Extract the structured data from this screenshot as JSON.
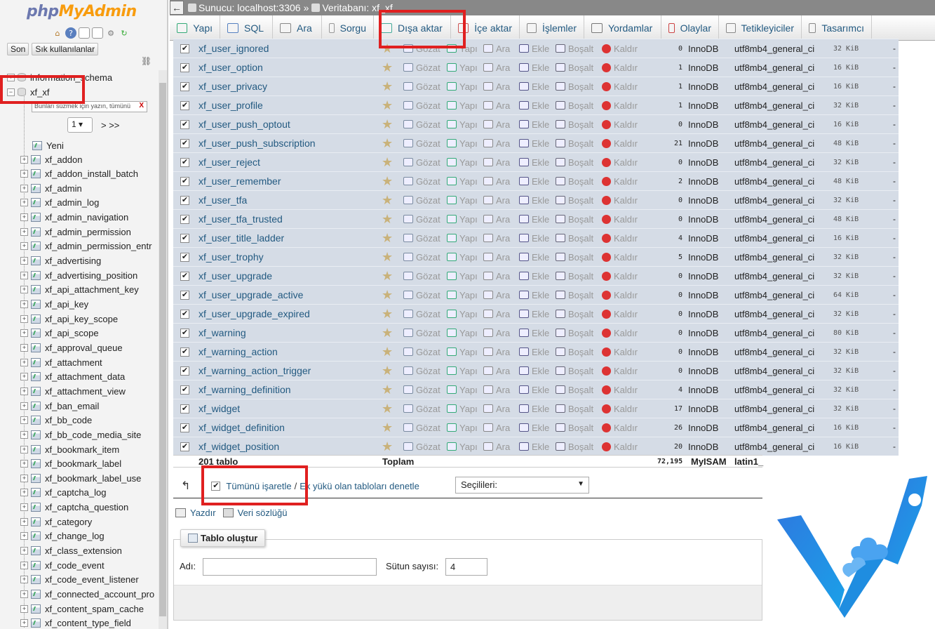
{
  "nav": {
    "logo_php": "php",
    "logo_myadmin": "MyAdmin",
    "buttons": [
      "Son",
      "Sık kullanılanlar"
    ],
    "db_items": [
      {
        "label": "information_schema"
      },
      {
        "label": "xf_xf"
      }
    ],
    "filter_placeholder": "Bunları süzmek için yazın, tümünü",
    "filter_clear": "X",
    "page_value": "1",
    "page_next": "> >>",
    "new_label": "Yeni",
    "tables": [
      "xf_addon",
      "xf_addon_install_batch",
      "xf_admin",
      "xf_admin_log",
      "xf_admin_navigation",
      "xf_admin_permission",
      "xf_admin_permission_entr",
      "xf_advertising",
      "xf_advertising_position",
      "xf_api_attachment_key",
      "xf_api_key",
      "xf_api_key_scope",
      "xf_api_scope",
      "xf_approval_queue",
      "xf_attachment",
      "xf_attachment_data",
      "xf_attachment_view",
      "xf_ban_email",
      "xf_bb_code",
      "xf_bb_code_media_site",
      "xf_bookmark_item",
      "xf_bookmark_label",
      "xf_bookmark_label_use",
      "xf_captcha_log",
      "xf_captcha_question",
      "xf_category",
      "xf_change_log",
      "xf_class_extension",
      "xf_code_event",
      "xf_code_event_listener",
      "xf_connected_account_pro",
      "xf_content_spam_cache",
      "xf_content_type_field"
    ]
  },
  "topbar": {
    "back": "←",
    "server": "Sunucu: localhost:3306",
    "sep": "»",
    "database": "Veritabanı: xf_xf"
  },
  "tabs": [
    {
      "label": "Yapı",
      "icon": "structure-icon",
      "color": "#3a7"
    },
    {
      "label": "SQL",
      "icon": "sql-icon",
      "color": "#5580c0"
    },
    {
      "label": "Ara",
      "icon": "search-icon",
      "color": "#888"
    },
    {
      "label": "Sorgu",
      "icon": "query-icon",
      "color": "#999"
    },
    {
      "label": "Dışa aktar",
      "icon": "export-icon",
      "color": "#4a9"
    },
    {
      "label": "İçe aktar",
      "icon": "import-icon",
      "color": "#c55"
    },
    {
      "label": "İşlemler",
      "icon": "wrench-icon",
      "color": "#888"
    },
    {
      "label": "Yordamlar",
      "icon": "routines-icon",
      "color": "#777"
    },
    {
      "label": "Olaylar",
      "icon": "clock-icon",
      "color": "#c44"
    },
    {
      "label": "Tetikleyiciler",
      "icon": "triggers-icon",
      "color": "#888"
    },
    {
      "label": "Tasarımcı",
      "icon": "designer-icon",
      "color": "#888"
    }
  ],
  "actions": {
    "browse": "Gözat",
    "structure": "Yapı",
    "search": "Ara",
    "insert": "Ekle",
    "empty": "Boşalt",
    "drop": "Kaldır"
  },
  "rows": [
    {
      "name": "xf_user_ignored",
      "rows": "0",
      "engine": "InnoDB",
      "collation": "utf8mb4_general_ci",
      "size": "32 KiB",
      "overhead": "-"
    },
    {
      "name": "xf_user_option",
      "rows": "1",
      "engine": "InnoDB",
      "collation": "utf8mb4_general_ci",
      "size": "16 KiB",
      "overhead": "-"
    },
    {
      "name": "xf_user_privacy",
      "rows": "1",
      "engine": "InnoDB",
      "collation": "utf8mb4_general_ci",
      "size": "16 KiB",
      "overhead": "-"
    },
    {
      "name": "xf_user_profile",
      "rows": "1",
      "engine": "InnoDB",
      "collation": "utf8mb4_general_ci",
      "size": "32 KiB",
      "overhead": "-"
    },
    {
      "name": "xf_user_push_optout",
      "rows": "0",
      "engine": "InnoDB",
      "collation": "utf8mb4_general_ci",
      "size": "16 KiB",
      "overhead": "-"
    },
    {
      "name": "xf_user_push_subscription",
      "rows": "21",
      "engine": "InnoDB",
      "collation": "utf8mb4_general_ci",
      "size": "48 KiB",
      "overhead": "-"
    },
    {
      "name": "xf_user_reject",
      "rows": "0",
      "engine": "InnoDB",
      "collation": "utf8mb4_general_ci",
      "size": "32 KiB",
      "overhead": "-"
    },
    {
      "name": "xf_user_remember",
      "rows": "2",
      "engine": "InnoDB",
      "collation": "utf8mb4_general_ci",
      "size": "48 KiB",
      "overhead": "-"
    },
    {
      "name": "xf_user_tfa",
      "rows": "0",
      "engine": "InnoDB",
      "collation": "utf8mb4_general_ci",
      "size": "32 KiB",
      "overhead": "-"
    },
    {
      "name": "xf_user_tfa_trusted",
      "rows": "0",
      "engine": "InnoDB",
      "collation": "utf8mb4_general_ci",
      "size": "48 KiB",
      "overhead": "-"
    },
    {
      "name": "xf_user_title_ladder",
      "rows": "4",
      "engine": "InnoDB",
      "collation": "utf8mb4_general_ci",
      "size": "16 KiB",
      "overhead": "-"
    },
    {
      "name": "xf_user_trophy",
      "rows": "5",
      "engine": "InnoDB",
      "collation": "utf8mb4_general_ci",
      "size": "32 KiB",
      "overhead": "-"
    },
    {
      "name": "xf_user_upgrade",
      "rows": "0",
      "engine": "InnoDB",
      "collation": "utf8mb4_general_ci",
      "size": "32 KiB",
      "overhead": "-"
    },
    {
      "name": "xf_user_upgrade_active",
      "rows": "0",
      "engine": "InnoDB",
      "collation": "utf8mb4_general_ci",
      "size": "64 KiB",
      "overhead": "-"
    },
    {
      "name": "xf_user_upgrade_expired",
      "rows": "0",
      "engine": "InnoDB",
      "collation": "utf8mb4_general_ci",
      "size": "32 KiB",
      "overhead": "-"
    },
    {
      "name": "xf_warning",
      "rows": "0",
      "engine": "InnoDB",
      "collation": "utf8mb4_general_ci",
      "size": "80 KiB",
      "overhead": "-"
    },
    {
      "name": "xf_warning_action",
      "rows": "0",
      "engine": "InnoDB",
      "collation": "utf8mb4_general_ci",
      "size": "32 KiB",
      "overhead": "-"
    },
    {
      "name": "xf_warning_action_trigger",
      "rows": "0",
      "engine": "InnoDB",
      "collation": "utf8mb4_general_ci",
      "size": "32 KiB",
      "overhead": "-"
    },
    {
      "name": "xf_warning_definition",
      "rows": "4",
      "engine": "InnoDB",
      "collation": "utf8mb4_general_ci",
      "size": "32 KiB",
      "overhead": "-"
    },
    {
      "name": "xf_widget",
      "rows": "17",
      "engine": "InnoDB",
      "collation": "utf8mb4_general_ci",
      "size": "32 KiB",
      "overhead": "-"
    },
    {
      "name": "xf_widget_definition",
      "rows": "26",
      "engine": "InnoDB",
      "collation": "utf8mb4_general_ci",
      "size": "16 KiB",
      "overhead": "-"
    },
    {
      "name": "xf_widget_position",
      "rows": "20",
      "engine": "InnoDB",
      "collation": "utf8mb4_general_ci",
      "size": "16 KiB",
      "overhead": "-"
    }
  ],
  "summary": {
    "tables": "201 tablo",
    "total": "Toplam",
    "rows": "72,195",
    "engine": "MyISAM",
    "collation": "latin1_"
  },
  "bulk": {
    "check_all": "Tümünü işaretle",
    "slash": "/",
    "check_overhead": "Ek yükü olan tabloları denetle",
    "with_selected": "Seçilileri:"
  },
  "print_label": "Yazdır",
  "dict_label": "Veri sözlüğü",
  "create": {
    "legend": "Tablo oluştur",
    "name_label": "Adı:",
    "cols_label": "Sütun sayısı:",
    "cols_value": "4"
  }
}
